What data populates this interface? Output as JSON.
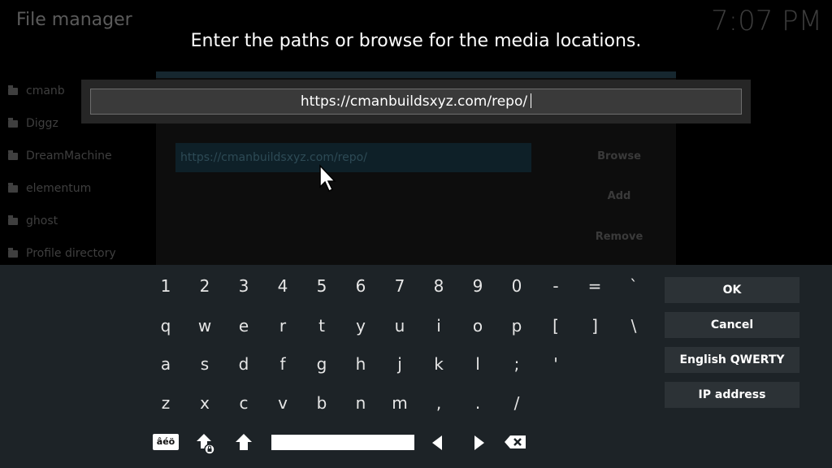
{
  "background": {
    "title": "File manager",
    "clock": "7:07 PM",
    "sources": [
      "cmanb",
      "Diggz",
      "DreamMachine",
      "elementum",
      "ghost",
      "Profile directory"
    ],
    "source_field": "https://cmanbuildsxyz.com/repo/",
    "buttons": [
      "Browse",
      "Add",
      "Remove"
    ]
  },
  "dialog": {
    "heading": "Enter the paths or browse for the media locations.",
    "input_value": "https://cmanbuildsxyz.com/repo/"
  },
  "keyboard": {
    "row1": [
      "1",
      "2",
      "3",
      "4",
      "5",
      "6",
      "7",
      "8",
      "9",
      "0",
      "-",
      "=",
      "`"
    ],
    "row2": [
      "q",
      "w",
      "e",
      "r",
      "t",
      "y",
      "u",
      "i",
      "o",
      "p",
      "[",
      "]",
      "\\"
    ],
    "row3": [
      "a",
      "s",
      "d",
      "f",
      "g",
      "h",
      "j",
      "k",
      "l",
      ";",
      "'"
    ],
    "row4": [
      "z",
      "x",
      "c",
      "v",
      "b",
      "n",
      "m",
      ",",
      ".",
      "/"
    ],
    "accent_key": "âéö",
    "side_buttons": {
      "ok": "OK",
      "cancel": "Cancel",
      "layout": "English QWERTY",
      "ip": "IP address"
    },
    "icons": [
      "shift-lock-icon",
      "shift-icon",
      "left-arrow-icon",
      "right-arrow-icon",
      "backspace-icon"
    ]
  }
}
